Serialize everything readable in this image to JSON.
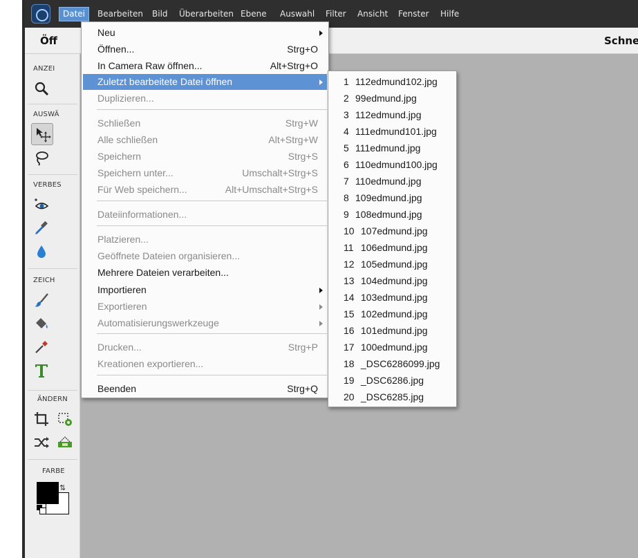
{
  "menubar": {
    "items": [
      "Datei",
      "Bearbeiten",
      "Bild",
      "Überarbeiten",
      "Ebene",
      "Auswahl",
      "Filter",
      "Ansicht",
      "Fenster",
      "Hilfe"
    ],
    "active": "Datei"
  },
  "options_bar": {
    "left_title": "Öff",
    "right_title": "Schnel"
  },
  "toolbox": {
    "sections": {
      "view": "ANZEI",
      "select": "AUSWÄ",
      "enhance": "VERBES",
      "draw": "ZEICH",
      "modify": "ÄNDERN",
      "color": "FARBE"
    }
  },
  "colors": {
    "accent": "#5d92d4",
    "menubar_bg": "#2f2f2f",
    "canvas_bg": "#b1b1b1",
    "foreground": "#000000",
    "background": "#ffffff"
  },
  "file_menu": {
    "items": [
      {
        "label": "Neu",
        "shortcut": "",
        "submenu": true,
        "disabled": false
      },
      {
        "label": "Öffnen...",
        "shortcut": "Strg+O",
        "submenu": false,
        "disabled": false
      },
      {
        "label": "In Camera Raw öffnen...",
        "shortcut": "Alt+Strg+O",
        "submenu": false,
        "disabled": false
      },
      {
        "label": "Zuletzt bearbeitete Datei öffnen",
        "shortcut": "",
        "submenu": true,
        "disabled": false,
        "highlighted": true
      },
      {
        "label": "Duplizieren...",
        "shortcut": "",
        "submenu": false,
        "disabled": true
      },
      {
        "label": "Schließen",
        "shortcut": "Strg+W",
        "submenu": false,
        "disabled": true
      },
      {
        "label": "Alle schließen",
        "shortcut": "Alt+Strg+W",
        "submenu": false,
        "disabled": true
      },
      {
        "label": "Speichern",
        "shortcut": "Strg+S",
        "submenu": false,
        "disabled": true
      },
      {
        "label": "Speichern unter...",
        "shortcut": "Umschalt+Strg+S",
        "submenu": false,
        "disabled": true
      },
      {
        "label": "Für Web speichern...",
        "shortcut": "Alt+Umschalt+Strg+S",
        "submenu": false,
        "disabled": true
      },
      {
        "label": "Dateiinformationen...",
        "shortcut": "",
        "submenu": false,
        "disabled": true
      },
      {
        "label": "Platzieren...",
        "shortcut": "",
        "submenu": false,
        "disabled": true
      },
      {
        "label": "Geöffnete Dateien organisieren...",
        "shortcut": "",
        "submenu": false,
        "disabled": true
      },
      {
        "label": "Mehrere Dateien verarbeiten...",
        "shortcut": "",
        "submenu": false,
        "disabled": false
      },
      {
        "label": "Importieren",
        "shortcut": "",
        "submenu": true,
        "disabled": false
      },
      {
        "label": "Exportieren",
        "shortcut": "",
        "submenu": true,
        "disabled": true
      },
      {
        "label": "Automatisierungswerkzeuge",
        "shortcut": "",
        "submenu": true,
        "disabled": true
      },
      {
        "label": "Drucken...",
        "shortcut": "Strg+P",
        "submenu": false,
        "disabled": true
      },
      {
        "label": "Kreationen exportieren...",
        "shortcut": "",
        "submenu": false,
        "disabled": true
      },
      {
        "label": "Beenden",
        "shortcut": "Strg+Q",
        "submenu": false,
        "disabled": false
      }
    ]
  },
  "recent_files": {
    "items": [
      {
        "num": "1",
        "name": "112edmund102.jpg"
      },
      {
        "num": "2",
        "name": "99edmund.jpg"
      },
      {
        "num": "3",
        "name": "112edmund.jpg"
      },
      {
        "num": "4",
        "name": "111edmund101.jpg"
      },
      {
        "num": "5",
        "name": "111edmund.jpg"
      },
      {
        "num": "6",
        "name": "110edmund100.jpg"
      },
      {
        "num": "7",
        "name": "110edmund.jpg"
      },
      {
        "num": "8",
        "name": "109edmund.jpg"
      },
      {
        "num": "9",
        "name": "108edmund.jpg"
      },
      {
        "num": "10",
        "name": "107edmund.jpg"
      },
      {
        "num": "11",
        "name": "106edmund.jpg"
      },
      {
        "num": "12",
        "name": "105edmund.jpg"
      },
      {
        "num": "13",
        "name": "104edmund.jpg"
      },
      {
        "num": "14",
        "name": "103edmund.jpg"
      },
      {
        "num": "15",
        "name": "102edmund.jpg"
      },
      {
        "num": "16",
        "name": "101edmund.jpg"
      },
      {
        "num": "17",
        "name": "100edmund.jpg"
      },
      {
        "num": "18",
        "name": "_DSC6286099.jpg"
      },
      {
        "num": "19",
        "name": "_DSC6286.jpg"
      },
      {
        "num": "20",
        "name": "_DSC6285.jpg"
      }
    ]
  }
}
